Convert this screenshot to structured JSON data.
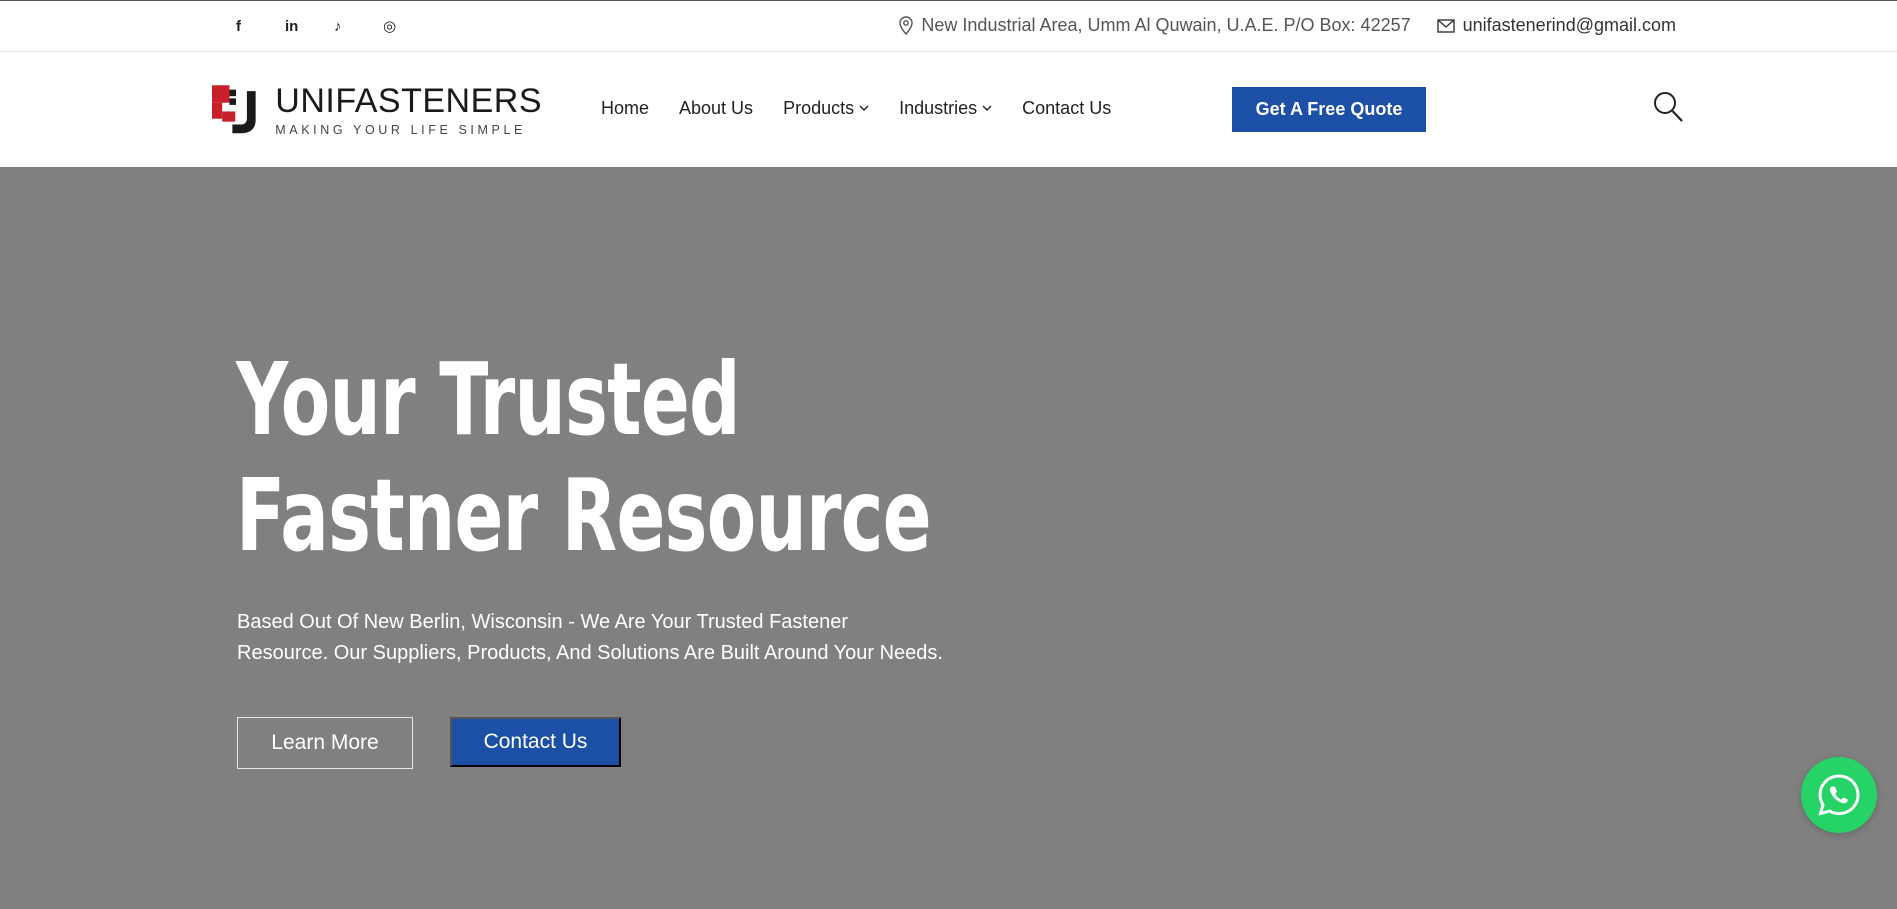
{
  "topbar": {
    "socials": [
      {
        "icon": "facebook-icon",
        "glyph": "f"
      },
      {
        "icon": "linkedin-icon",
        "glyph": "in"
      },
      {
        "icon": "tiktok-icon",
        "glyph": "♪"
      },
      {
        "icon": "instagram-icon",
        "glyph": "◎"
      }
    ],
    "address": "New Industrial Area, Umm Al Quwain, U.A.E. P/O Box: 42257",
    "email": "unifastenerind@gmail.com"
  },
  "brand": {
    "name": "UNIFASTENERS",
    "tagline": "MAKING YOUR LIFE SIMPLE",
    "colors": {
      "red": "#c8202a",
      "dark": "#1a1a1a"
    }
  },
  "nav": {
    "items": [
      {
        "label": "Home",
        "dropdown": false
      },
      {
        "label": "About Us",
        "dropdown": false
      },
      {
        "label": "Products",
        "dropdown": true
      },
      {
        "label": "Industries",
        "dropdown": true
      },
      {
        "label": "Contact Us",
        "dropdown": false
      }
    ],
    "quote_label": "Get A Free Quote"
  },
  "hero": {
    "title_line1": "Your Trusted",
    "title_line2": "Fastner Resource",
    "subtitle_line1": "Based Out Of New Berlin, Wisconsin - We Are Your Trusted Fastener",
    "subtitle_line2": "Resource. Our Suppliers, Products, And Solutions Are Built Around Your Needs.",
    "learn_more_label": "Learn More",
    "contact_label": "Contact Us"
  },
  "colors": {
    "accent": "#1c4fa6",
    "hero_bg": "#808080",
    "whatsapp": "#25d366"
  }
}
